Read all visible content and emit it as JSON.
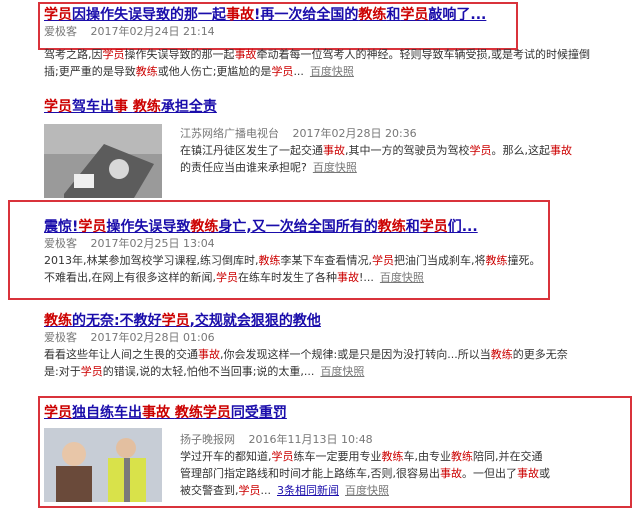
{
  "results": [
    {
      "title_parts": [
        [
          "学员",
          "hl"
        ],
        [
          "因操作失误导致的那一起",
          ""
        ],
        [
          "事故",
          "hl"
        ],
        [
          "!再一次给全国的",
          ""
        ],
        [
          "教练",
          "hl"
        ],
        [
          "和",
          ""
        ],
        [
          "学员",
          "hl"
        ],
        [
          "敲响了...",
          ""
        ]
      ],
      "source": "爱极客",
      "date": "2017年02月24日 21:14",
      "snippet_parts": [
        [
          "驾考之路,因",
          ""
        ],
        [
          "学员",
          "hl"
        ],
        [
          "操作失误导致的那一起",
          ""
        ],
        [
          "事故",
          "hl"
        ],
        [
          "牵动着每一位驾考人的神经。轻则导致车辆受损,或是考试的时候撞倒插;更严重的是导致",
          ""
        ],
        [
          "教练",
          "hl"
        ],
        [
          "或他人伤亡;更尴尬的是",
          ""
        ],
        [
          "学员",
          "hl"
        ],
        [
          "...",
          ""
        ]
      ],
      "snapshot": "百度快照"
    },
    {
      "title_parts": [
        [
          "学员",
          "hl"
        ],
        [
          "驾车出",
          ""
        ],
        [
          "事",
          "hl"
        ],
        [
          " ",
          ""
        ],
        [
          "教练",
          "hl"
        ],
        [
          "承担全责",
          ""
        ]
      ],
      "source": "江苏网络广播电视台",
      "date": "2017年02月28日 20:36",
      "snippet_parts": [
        [
          "在镇江丹徒区发生了一起交通",
          ""
        ],
        [
          "事故",
          "hl"
        ],
        [
          ",其中一方的驾驶员为驾校",
          ""
        ],
        [
          "学员",
          "hl"
        ],
        [
          "。那么,这起",
          ""
        ],
        [
          "事故",
          "hl"
        ],
        [
          "的责任应当由谁来承担呢?",
          ""
        ]
      ],
      "snapshot": "百度快照"
    },
    {
      "title_parts": [
        [
          "震惊!",
          ""
        ],
        [
          "学员",
          "hl"
        ],
        [
          "操作失误导致",
          ""
        ],
        [
          "教练",
          "hl"
        ],
        [
          "身亡,又一次给全国所有的",
          ""
        ],
        [
          "教练",
          "hl"
        ],
        [
          "和",
          ""
        ],
        [
          "学员",
          "hl"
        ],
        [
          "们...",
          ""
        ]
      ],
      "source": "爱极客",
      "date": "2017年02月25日 13:04",
      "snippet_parts": [
        [
          "2013年,林某参加驾校学习课程,练习倒库时,",
          ""
        ],
        [
          "教练",
          "hl"
        ],
        [
          "李某下车查看情况,",
          ""
        ],
        [
          "学员",
          "hl"
        ],
        [
          "把油门当成刹车,将",
          ""
        ],
        [
          "教练",
          "hl"
        ],
        [
          "撞死。不难看出,在网上有很多这样的新闻,",
          ""
        ],
        [
          "学员",
          "hl"
        ],
        [
          "在练车时发生了各种",
          ""
        ],
        [
          "事故",
          "hl"
        ],
        [
          "!...",
          ""
        ]
      ],
      "snapshot": "百度快照"
    },
    {
      "title_parts": [
        [
          "教练",
          "hl"
        ],
        [
          "的无奈:不教好",
          ""
        ],
        [
          "学员",
          "hl"
        ],
        [
          ",交规就会狠狠的教他",
          ""
        ]
      ],
      "source": "爱极客",
      "date": "2017年02月28日 01:06",
      "snippet_parts": [
        [
          "看看这些年让人间之生畏的交通",
          ""
        ],
        [
          "事故",
          "hl"
        ],
        [
          ",你会发现这样一个规律:或是只是因为没打转向...所以当",
          ""
        ],
        [
          "教练",
          "hl"
        ],
        [
          "的更多无奈是:对于",
          ""
        ],
        [
          "学员",
          "hl"
        ],
        [
          "的错误,说的太轻,怕他不当回事;说的太重,...",
          ""
        ]
      ],
      "snapshot": "百度快照"
    },
    {
      "title_parts": [
        [
          "学员",
          "hl"
        ],
        [
          "独自练车出",
          ""
        ],
        [
          "事故",
          "hl"
        ],
        [
          " ",
          ""
        ],
        [
          "教练",
          "hl"
        ],
        [
          "学员",
          "hl"
        ],
        [
          "同受重罚",
          ""
        ]
      ],
      "source": "扬子晚报网",
      "date": "2016年11月13日 10:48",
      "snippet_parts": [
        [
          "学过开车的都知道,",
          ""
        ],
        [
          "学员",
          "hl"
        ],
        [
          "练车一定要用专业",
          ""
        ],
        [
          "教练",
          "hl"
        ],
        [
          "车,由专业",
          ""
        ],
        [
          "教练",
          "hl"
        ],
        [
          "陪同,并在交通管理部门指定路线和时间才能上路练车,否则,很容易出",
          ""
        ],
        [
          "事故",
          "hl"
        ],
        [
          "。一但出了",
          ""
        ],
        [
          "事故",
          "hl"
        ],
        [
          "或被交警查到,",
          ""
        ],
        [
          "学员",
          "hl"
        ],
        [
          "...",
          ""
        ]
      ],
      "more": "3条相同新闻",
      "snapshot": "百度快照"
    }
  ]
}
